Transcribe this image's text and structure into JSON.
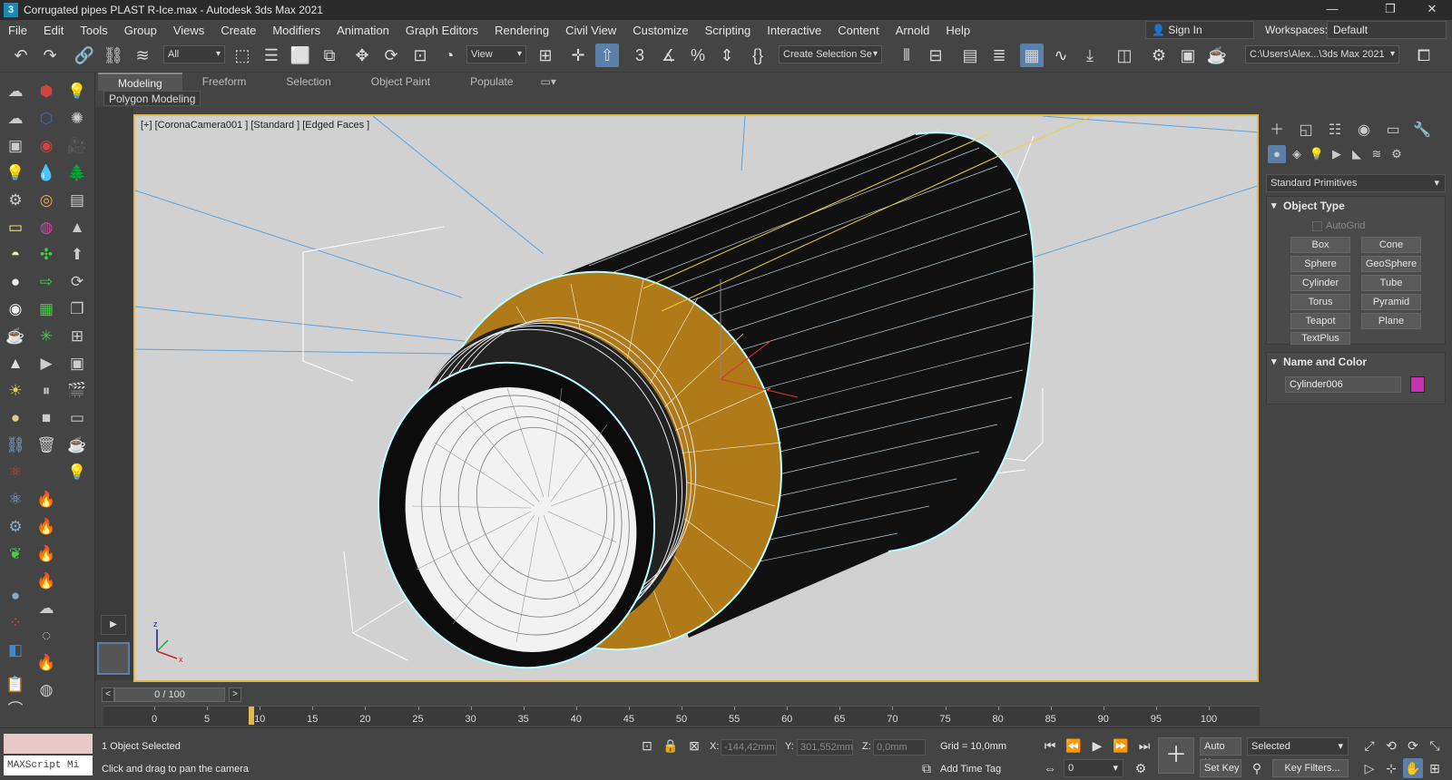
{
  "window": {
    "title": "Corrugated pipes PLAST R-Ice.max - Autodesk 3ds Max 2021",
    "app_icon": "3"
  },
  "menu": [
    "File",
    "Edit",
    "Tools",
    "Group",
    "Views",
    "Create",
    "Modifiers",
    "Animation",
    "Graph Editors",
    "Rendering",
    "Civil View",
    "Customize",
    "Scripting",
    "Interactive",
    "Content",
    "Arnold",
    "Help"
  ],
  "account": {
    "sign_in": "Sign In",
    "workspaces_label": "Workspaces:",
    "workspace": "Default"
  },
  "toolbar": {
    "filter": "All",
    "ref_coord": "View",
    "selection_set": "Create Selection Se",
    "project_path": "C:\\Users\\Alex...\\3ds Max 2021"
  },
  "ribbon": {
    "tabs": [
      "Modeling",
      "Freeform",
      "Selection",
      "Object Paint",
      "Populate"
    ],
    "active": "Modeling",
    "panel": "Polygon Modeling"
  },
  "viewport": {
    "label": "[+] [CoronaCamera001 ] [Standard ] [Edged Faces ]"
  },
  "command_panel": {
    "category": "Standard Primitives",
    "object_type": {
      "title": "Object Type",
      "autogrid": "AutoGrid",
      "buttons": [
        "Box",
        "Cone",
        "Sphere",
        "GeoSphere",
        "Cylinder",
        "Tube",
        "Torus",
        "Pyramid",
        "Teapot",
        "Plane",
        "TextPlus"
      ]
    },
    "name_color": {
      "title": "Name and Color",
      "name": "Cylinder006",
      "color": "#c433b0"
    }
  },
  "timeline": {
    "frame": "0 / 100",
    "ticks": [
      "0",
      "5",
      "10",
      "15",
      "20",
      "25",
      "30",
      "35",
      "40",
      "45",
      "50",
      "55",
      "60",
      "65",
      "70",
      "75",
      "80",
      "85",
      "90",
      "95",
      "100"
    ]
  },
  "status": {
    "selected": "1 Object Selected",
    "prompt": "Click and drag to pan the camera",
    "maxscript": "MAXScript Mi",
    "x_label": "X:",
    "x": "-144,42mm",
    "y_label": "Y:",
    "y": "301,552mm",
    "z_label": "Z:",
    "z": "0,0mm",
    "grid": "Grid = 10,0mm",
    "add_time_tag": "Add Time Tag",
    "auto_key": "Auto K...",
    "set_key": "Set Key",
    "key_mode": "Selected",
    "key_filters": "Key Filters...",
    "frame": "0"
  }
}
